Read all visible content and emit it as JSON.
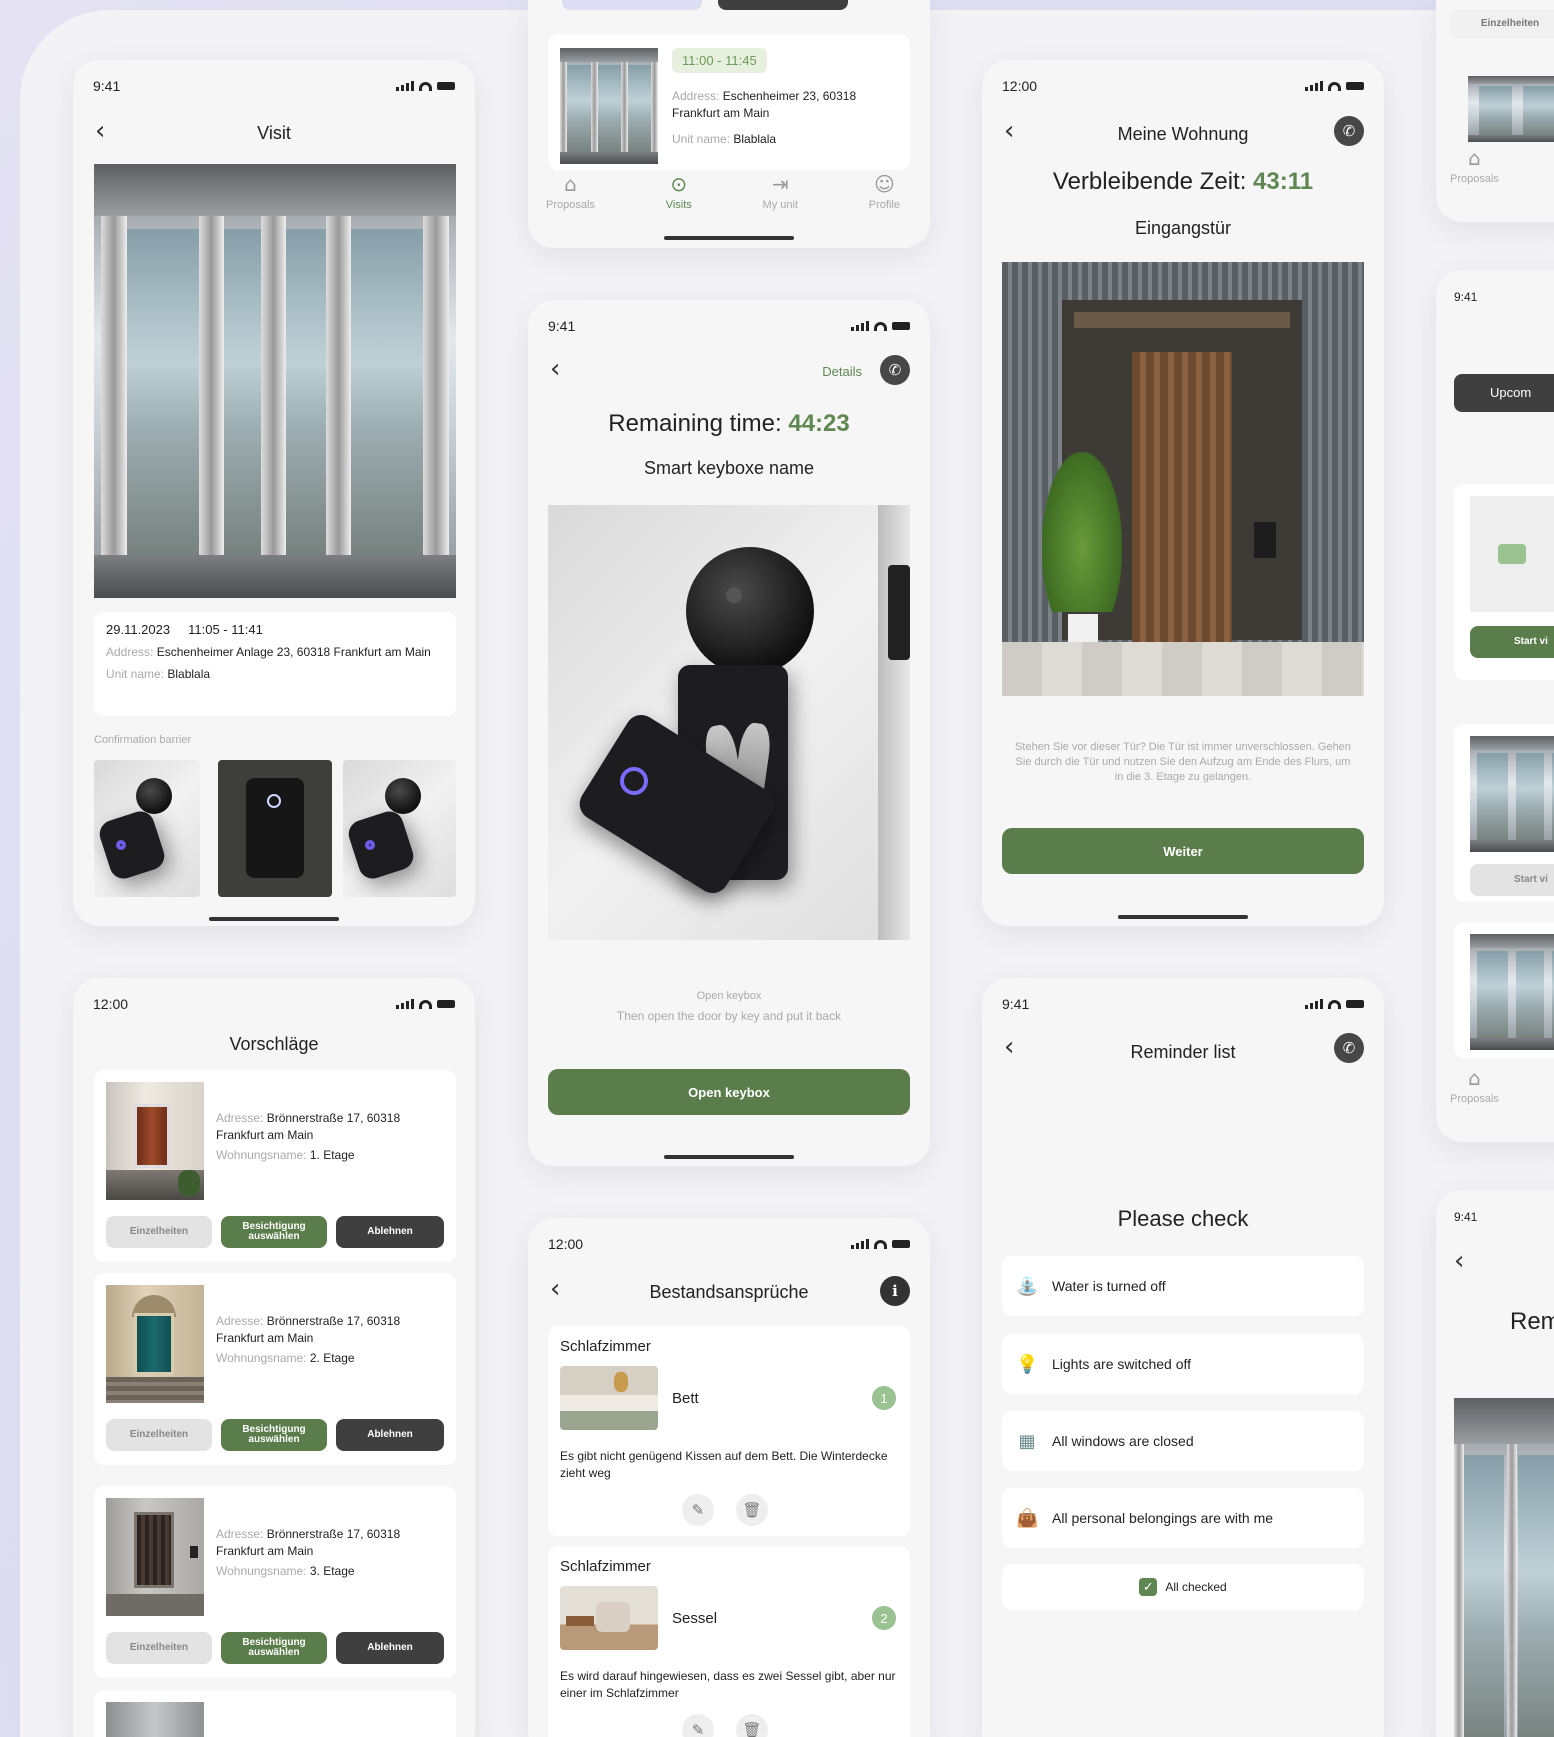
{
  "visit": {
    "time": "9:41",
    "title": "Visit",
    "date": "29.11.2023",
    "time_range": "11:05 - 11:41",
    "address_label": "Address:",
    "address_value": "Eschenheimer Anlage 23, 60318 Frankfurt am Main",
    "unit_label": "Unit name:",
    "unit_value": "Blablala",
    "confirmation_label": "Confirmation barrier"
  },
  "proposals_tabbar_phone": {
    "time_chip": "11:00 - 11:45",
    "address_label": "Address:",
    "address_value": "Eschenheimer 23, 60318 Frankfurt am Main",
    "unit_label": "Unit name:",
    "unit_value": "Blablala",
    "tabs": [
      {
        "label": "Proposals",
        "icon": "home-icon"
      },
      {
        "label": "Visits",
        "icon": "location-pin-icon"
      },
      {
        "label": "My unit",
        "icon": "login-icon"
      },
      {
        "label": "Profile",
        "icon": "user-icon"
      }
    ]
  },
  "keybox": {
    "time": "9:41",
    "details_link": "Details",
    "remaining_label": "Remaining time:",
    "remaining_value": "44:23",
    "subtitle": "Smart keyboxe name",
    "instruction_1": "Open keybox",
    "instruction_2": "Then open the door by key and put it back",
    "button": "Open keybox"
  },
  "wohnung": {
    "time": "12:00",
    "title": "Meine Wohnung",
    "remaining_label": "Verbleibende Zeit:",
    "remaining_value": "43:11",
    "subtitle": "Eingangstür",
    "description": "Stehen Sie vor dieser Tür? Die Tür ist immer unverschlossen. Gehen Sie durch die Tür und nutzen Sie den Aufzug am Ende des Flurs, um in die 3. Etage zu gelangen.",
    "button": "Weiter"
  },
  "vorschlaege": {
    "time": "12:00",
    "title": "Vorschläge",
    "address_label": "Adresse:",
    "unit_label": "Wohnungsname:",
    "btn_details": "Einzelheiten",
    "btn_select": "Besichtigung auswählen",
    "btn_reject": "Ablehnen",
    "items": [
      {
        "address": "Brönnerstraße 17, 60318 Frankfurt am Main",
        "unit": "1. Etage"
      },
      {
        "address": "Brönnerstraße 17, 60318 Frankfurt am Main",
        "unit": "2. Etage"
      },
      {
        "address": "Brönnerstraße 17, 60318 Frankfurt am Main",
        "unit": "3. Etage"
      }
    ]
  },
  "bestand": {
    "time": "12:00",
    "title": "Bestandsansprüche",
    "items": [
      {
        "room": "Schlafzimmer",
        "item": "Bett",
        "badge": "1",
        "text": "Es gibt nicht genügend Kissen auf dem Bett. Die Winterdecke zieht weg"
      },
      {
        "room": "Schlafzimmer",
        "item": "Sessel",
        "badge": "2",
        "text": "Es wird darauf hingewiesen, dass es zwei Sessel gibt, aber nur einer im Schlafzimmer"
      }
    ]
  },
  "reminder": {
    "time": "9:41",
    "title": "Reminder list",
    "heading": "Please check",
    "rows": [
      {
        "label": "Water is turned off",
        "icon": "faucet-icon"
      },
      {
        "label": "Lights are switched off",
        "icon": "lightbulb-icon"
      },
      {
        "label": "All windows are closed",
        "icon": "window-icon"
      },
      {
        "label": "All personal belongings are with me",
        "icon": "bag-icon"
      }
    ],
    "all_checked": "All checked"
  },
  "right_column": {
    "top_chip": "Einzelheiten",
    "proposals_tab": "Proposals",
    "time_1": "9:41",
    "upcoming": "Upcom",
    "start_video": "Start vi",
    "start_video_2": "Start vi",
    "proposals_tab_2": "Proposals",
    "time_2": "9:41",
    "rem": "Rem"
  },
  "colors": {
    "accent_green": "#5a7d4b",
    "timer_green": "#5f8752",
    "background": "#e2e1f2"
  }
}
